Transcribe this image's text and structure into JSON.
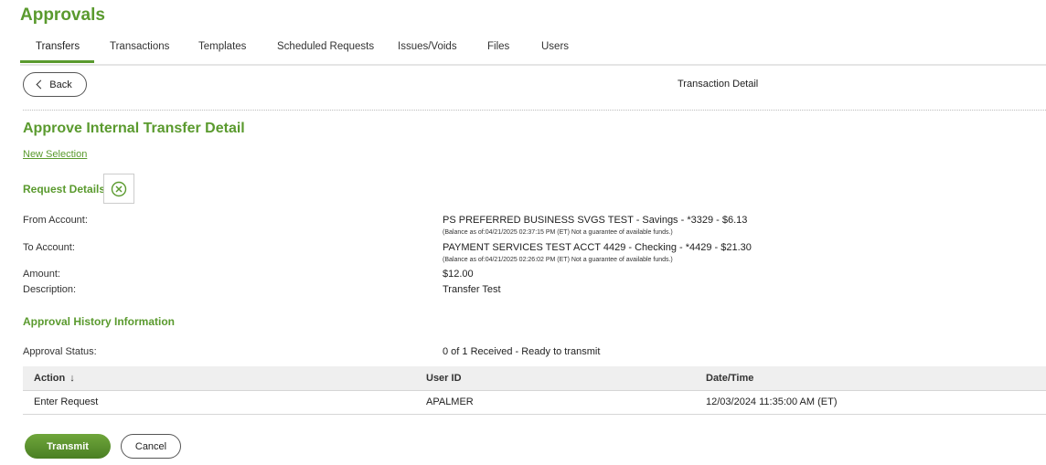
{
  "page": {
    "title": "Approvals"
  },
  "tabs": [
    "Transfers",
    "Transactions",
    "Templates",
    "Scheduled Requests",
    "Issues/Voids",
    "Files",
    "Users"
  ],
  "toolbar": {
    "back_label": "Back",
    "context_title": "Transaction Detail"
  },
  "detail": {
    "title": "Approve Internal Transfer Detail",
    "new_selection": "New Selection",
    "request_details_label": "Request Details",
    "from_label": "From Account:",
    "from_value": "PS PREFERRED BUSINESS SVGS TEST - Savings - *3329 - $6.13",
    "from_note": "(Balance as of:04/21/2025 02:37:15 PM (ET) Not a guarantee of available funds.)",
    "to_label": "To Account:",
    "to_value": "PAYMENT SERVICES TEST ACCT 4429 - Checking - *4429 - $21.30",
    "to_note": "(Balance as of:04/21/2025 02:26:02 PM (ET) Not a guarantee of available funds.)",
    "amount_label": "Amount:",
    "amount_value": "$12.00",
    "description_label": "Description:",
    "description_value": "Transfer Test"
  },
  "history": {
    "title": "Approval History Information",
    "status_label": "Approval Status:",
    "status_value": "0 of 1 Received - Ready to transmit",
    "columns": [
      "Action",
      "User ID",
      "Date/Time"
    ],
    "rows": [
      {
        "action": "Enter Request",
        "user_id": "APALMER",
        "datetime": "12/03/2024 11:35:00 AM (ET)"
      }
    ]
  },
  "actions": {
    "transmit_label": "Transmit",
    "cancel_label": "Cancel"
  },
  "colors": {
    "accent": "#5a9a2e",
    "transmit_bg": "#4a7f23"
  },
  "icons": {
    "back": "chevron-left-icon",
    "close": "circle-x-icon",
    "sort": "arrow-down-icon"
  }
}
